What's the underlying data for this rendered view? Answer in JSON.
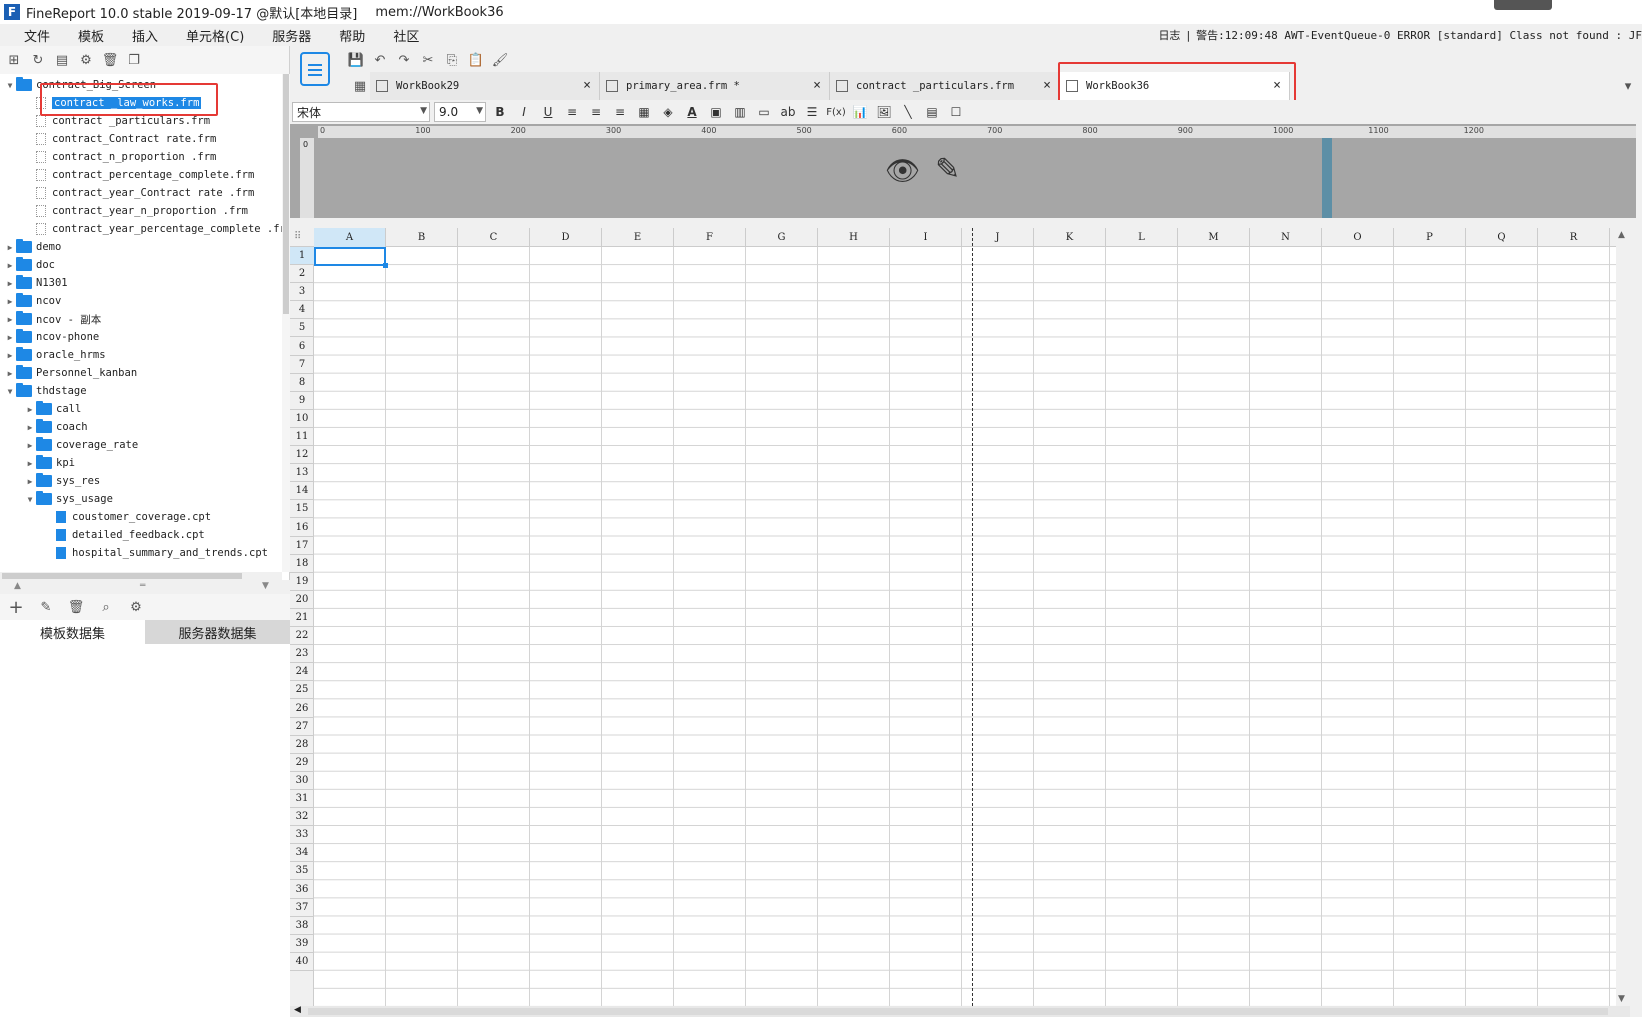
{
  "window": {
    "title": "FineReport 10.0 stable 2019-09-17 @默认[本地目录]",
    "path": "mem://WorkBook36"
  },
  "menu": {
    "items": [
      "文件",
      "模板",
      "插入",
      "单元格(C)",
      "服务器",
      "帮助",
      "社区"
    ],
    "log_label": "日志",
    "log_message": "警告:12:09:48 AWT-EventQueue-0 ERROR [standard] Class not found : JF"
  },
  "tree": {
    "nodes": [
      {
        "label": "contract_Big_Screen",
        "type": "folder",
        "depth": 0,
        "expanded": true
      },
      {
        "label": "contract _law_works.frm",
        "type": "file",
        "depth": 1,
        "selected": true
      },
      {
        "label": "contract _particulars.frm",
        "type": "file",
        "depth": 1
      },
      {
        "label": "contract_Contract rate.frm",
        "type": "file",
        "depth": 1
      },
      {
        "label": "contract_n_proportion .frm",
        "type": "file",
        "depth": 1
      },
      {
        "label": "contract_percentage_complete.frm",
        "type": "file",
        "depth": 1
      },
      {
        "label": "contract_year_Contract rate .frm",
        "type": "file",
        "depth": 1
      },
      {
        "label": "contract_year_n_proportion .frm",
        "type": "file",
        "depth": 1
      },
      {
        "label": "contract_year_percentage_complete .fr",
        "type": "file",
        "depth": 1
      },
      {
        "label": "demo",
        "type": "folder",
        "depth": 0
      },
      {
        "label": "doc",
        "type": "folder",
        "depth": 0
      },
      {
        "label": "N1301",
        "type": "folder",
        "depth": 0
      },
      {
        "label": "ncov",
        "type": "folder",
        "depth": 0
      },
      {
        "label": "ncov - 副本",
        "type": "folder",
        "depth": 0
      },
      {
        "label": "ncov-phone",
        "type": "folder",
        "depth": 0
      },
      {
        "label": "oracle_hrms",
        "type": "folder",
        "depth": 0
      },
      {
        "label": "Personnel_kanban",
        "type": "folder",
        "depth": 0
      },
      {
        "label": "thdstage",
        "type": "folder",
        "depth": 0,
        "expanded": true
      },
      {
        "label": "call",
        "type": "folder",
        "depth": 1
      },
      {
        "label": "coach",
        "type": "folder",
        "depth": 1
      },
      {
        "label": "coverage_rate",
        "type": "folder",
        "depth": 1
      },
      {
        "label": "kpi",
        "type": "folder",
        "depth": 1
      },
      {
        "label": "sys_res",
        "type": "folder",
        "depth": 1
      },
      {
        "label": "sys_usage",
        "type": "folder",
        "depth": 1,
        "expanded": true
      },
      {
        "label": "coustomer_coverage.cpt",
        "type": "cpt",
        "depth": 2
      },
      {
        "label": "detailed_feedback.cpt",
        "type": "cpt",
        "depth": 2
      },
      {
        "label": "hospital_summary_and_trends.cpt",
        "type": "cpt",
        "depth": 2
      }
    ]
  },
  "dataset_tabs": [
    "模板数据集",
    "服务器数据集"
  ],
  "doc_tabs": [
    {
      "label": "WorkBook29",
      "active": false
    },
    {
      "label": "primary_area.frm *",
      "active": false
    },
    {
      "label": "contract _particulars.frm",
      "active": false
    },
    {
      "label": "WorkBook36",
      "active": true
    }
  ],
  "format": {
    "font": "宋体",
    "size": "9.0",
    "bold": "B",
    "italic": "I",
    "underline": "U",
    "text_color": "A",
    "wrap": "ab",
    "formula": "F(x)"
  },
  "ruler": {
    "ticks": [
      "0",
      "100",
      "200",
      "300",
      "400",
      "500",
      "600",
      "700",
      "800",
      "900",
      "1000",
      "1100",
      "1200"
    ],
    "vertical_zero": "0"
  },
  "grid": {
    "columns": [
      "A",
      "B",
      "C",
      "D",
      "E",
      "F",
      "G",
      "H",
      "I",
      "J",
      "K",
      "L",
      "M",
      "N",
      "O",
      "P",
      "Q",
      "R"
    ],
    "rows": [
      "1",
      "2",
      "3",
      "4",
      "5",
      "6",
      "7",
      "8",
      "9",
      "10",
      "11",
      "12",
      "13",
      "14",
      "15",
      "16",
      "17",
      "18",
      "19",
      "20",
      "21",
      "22",
      "23",
      "24",
      "25",
      "26",
      "27",
      "28",
      "29",
      "30",
      "31",
      "32",
      "33",
      "34",
      "35",
      "36",
      "37",
      "38",
      "39",
      "40"
    ],
    "selected_cell": "A1"
  },
  "colors": {
    "accent": "#1e88e5",
    "highlight": "#e53935"
  }
}
